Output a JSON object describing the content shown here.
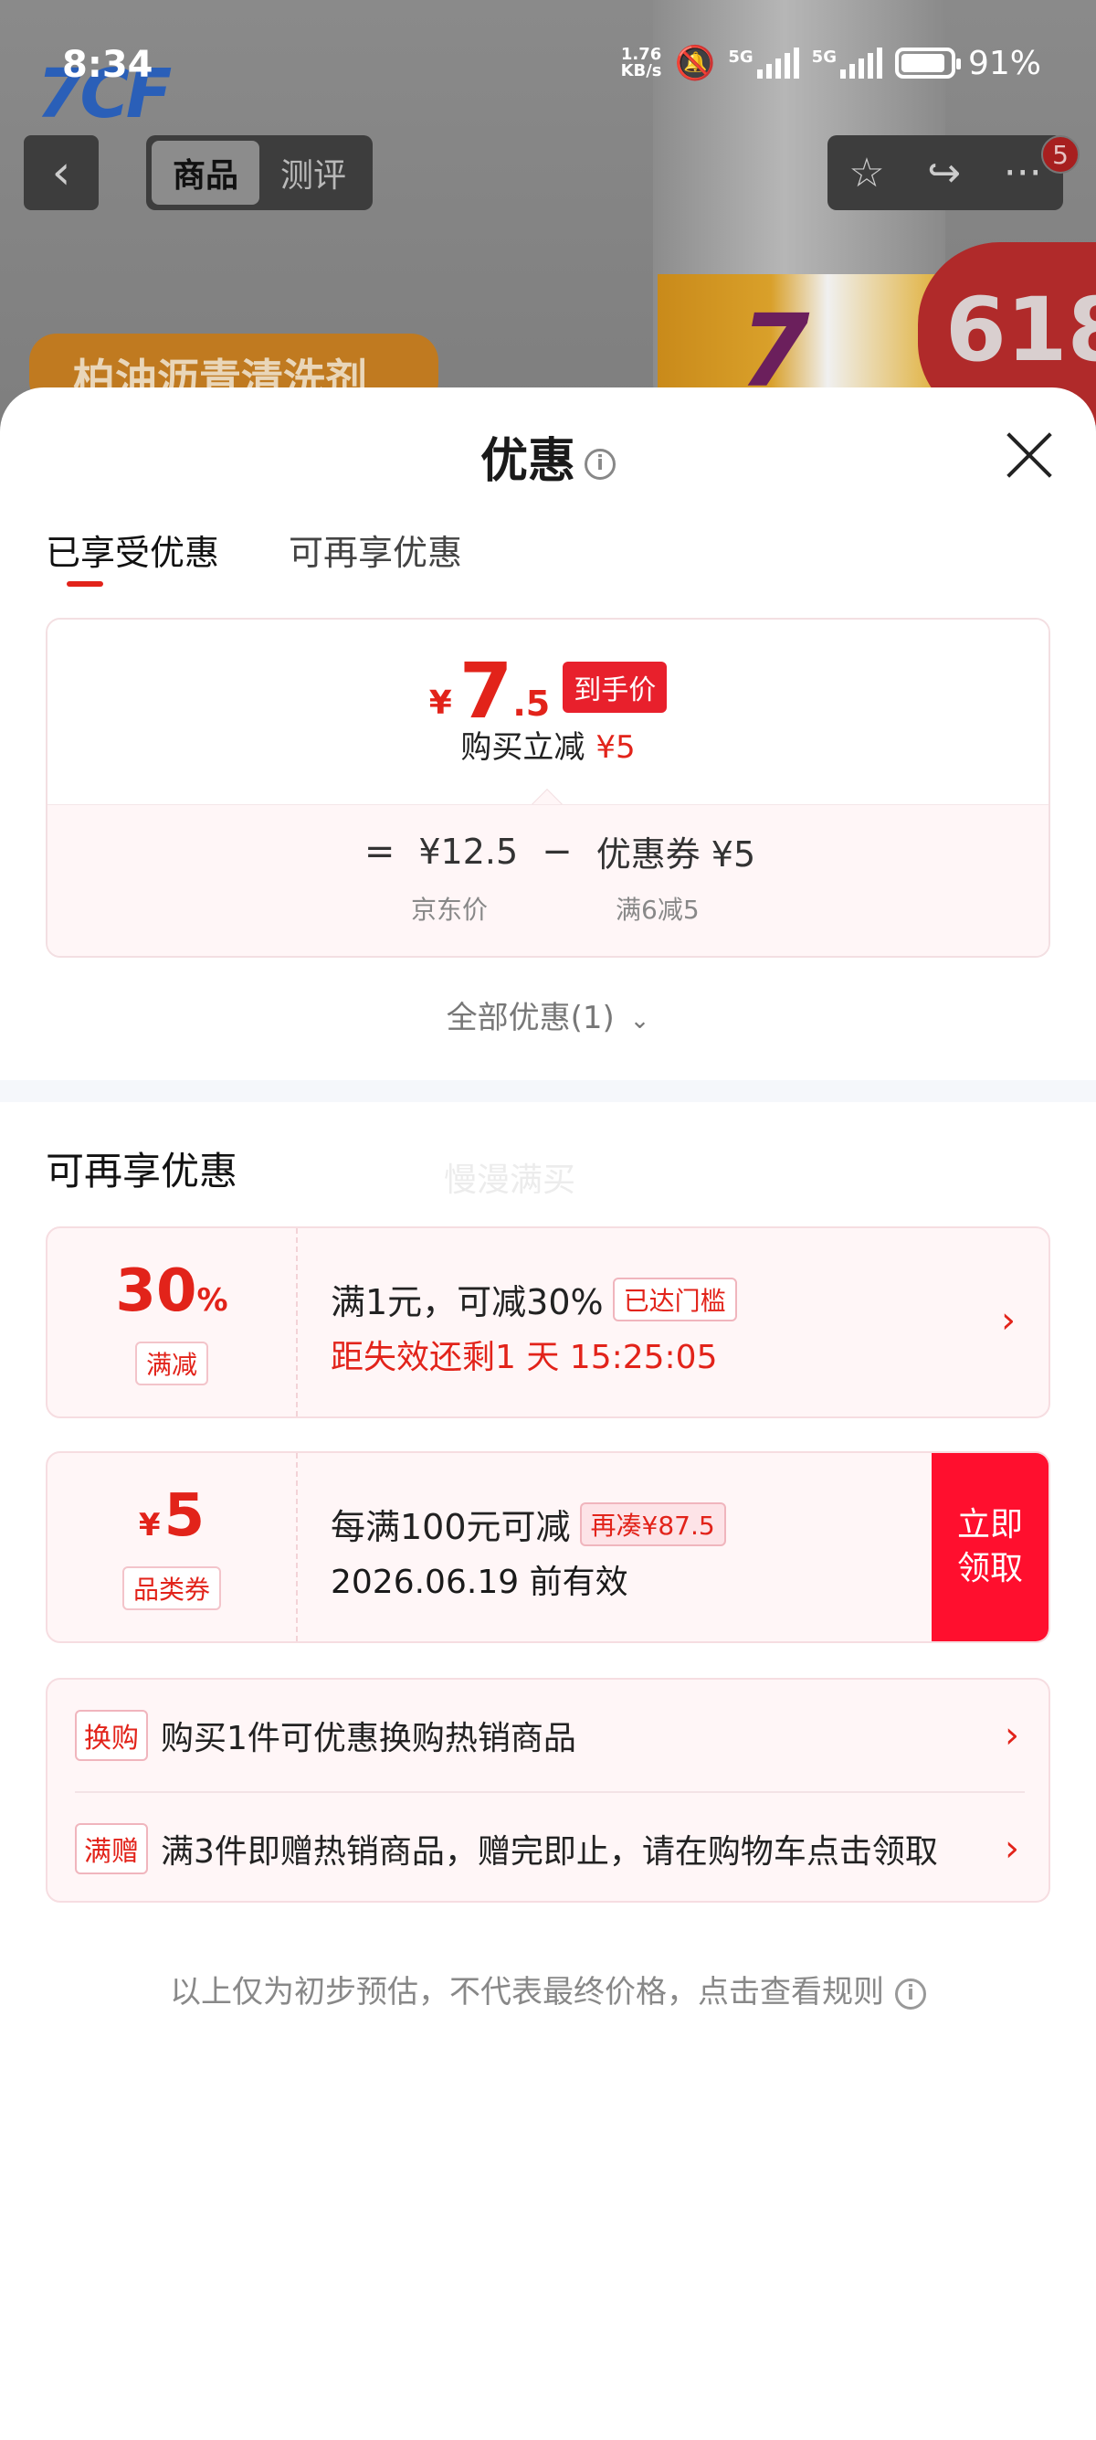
{
  "status": {
    "time": "8:34",
    "speed_value": "1.76",
    "speed_unit": "KB/s",
    "net1": "5G",
    "net2": "5G",
    "battery": "91%"
  },
  "background": {
    "logo": "7CF",
    "product_tag": "柏油沥青清洗剂",
    "promo": "618",
    "bottle_mark": "7"
  },
  "nav": {
    "back_label": "‹",
    "tabs": [
      {
        "label": "商品",
        "active": true
      },
      {
        "label": "测评",
        "active": false
      }
    ],
    "badge_count": "5"
  },
  "sheet": {
    "title": "优惠",
    "info_glyph": "i",
    "tabs": [
      {
        "label": "已享受优惠",
        "active": true
      },
      {
        "label": "可再享优惠",
        "active": false
      }
    ],
    "price": {
      "yen": "¥",
      "int": "7",
      "dec": ".5",
      "badge": "到手价",
      "reduce_label": "购买立减",
      "reduce_amount": "¥5",
      "formula_eq": "=",
      "formula_price": "¥12.5",
      "formula_minus": "−",
      "formula_coupon": "优惠券 ¥5",
      "price_label": "京东价",
      "coupon_label": "满6减5"
    },
    "all_promo": "全部优惠(1)",
    "section_title": "可再享优惠",
    "watermark": "慢漫满买",
    "coupons": [
      {
        "big": "30",
        "big_unit": "%",
        "tag": "满减",
        "main": "满1元，可减30%",
        "pill": "已达门槛",
        "sub": "距失效还剩1 天 15:25:05"
      },
      {
        "yen": "¥",
        "big": "5",
        "tag": "品类券",
        "main": "每满100元可减",
        "pill": "再凑¥87.5",
        "sub": "2026.06.19 前有效",
        "button_line1": "立即",
        "button_line2": "领取"
      }
    ],
    "list": [
      {
        "tag": "换购",
        "text": "购买1件可优惠换购热销商品"
      },
      {
        "tag": "满赠",
        "text": "满3件即赠热销商品，赠完即止，请在购物车点击领取"
      }
    ],
    "footer_note": "以上仅为初步预估，不代表最终价格，点击查看规则"
  },
  "colors": {
    "accent": "#e2231a",
    "button": "#ff0f2e",
    "card_bg": "#fff6f7"
  }
}
